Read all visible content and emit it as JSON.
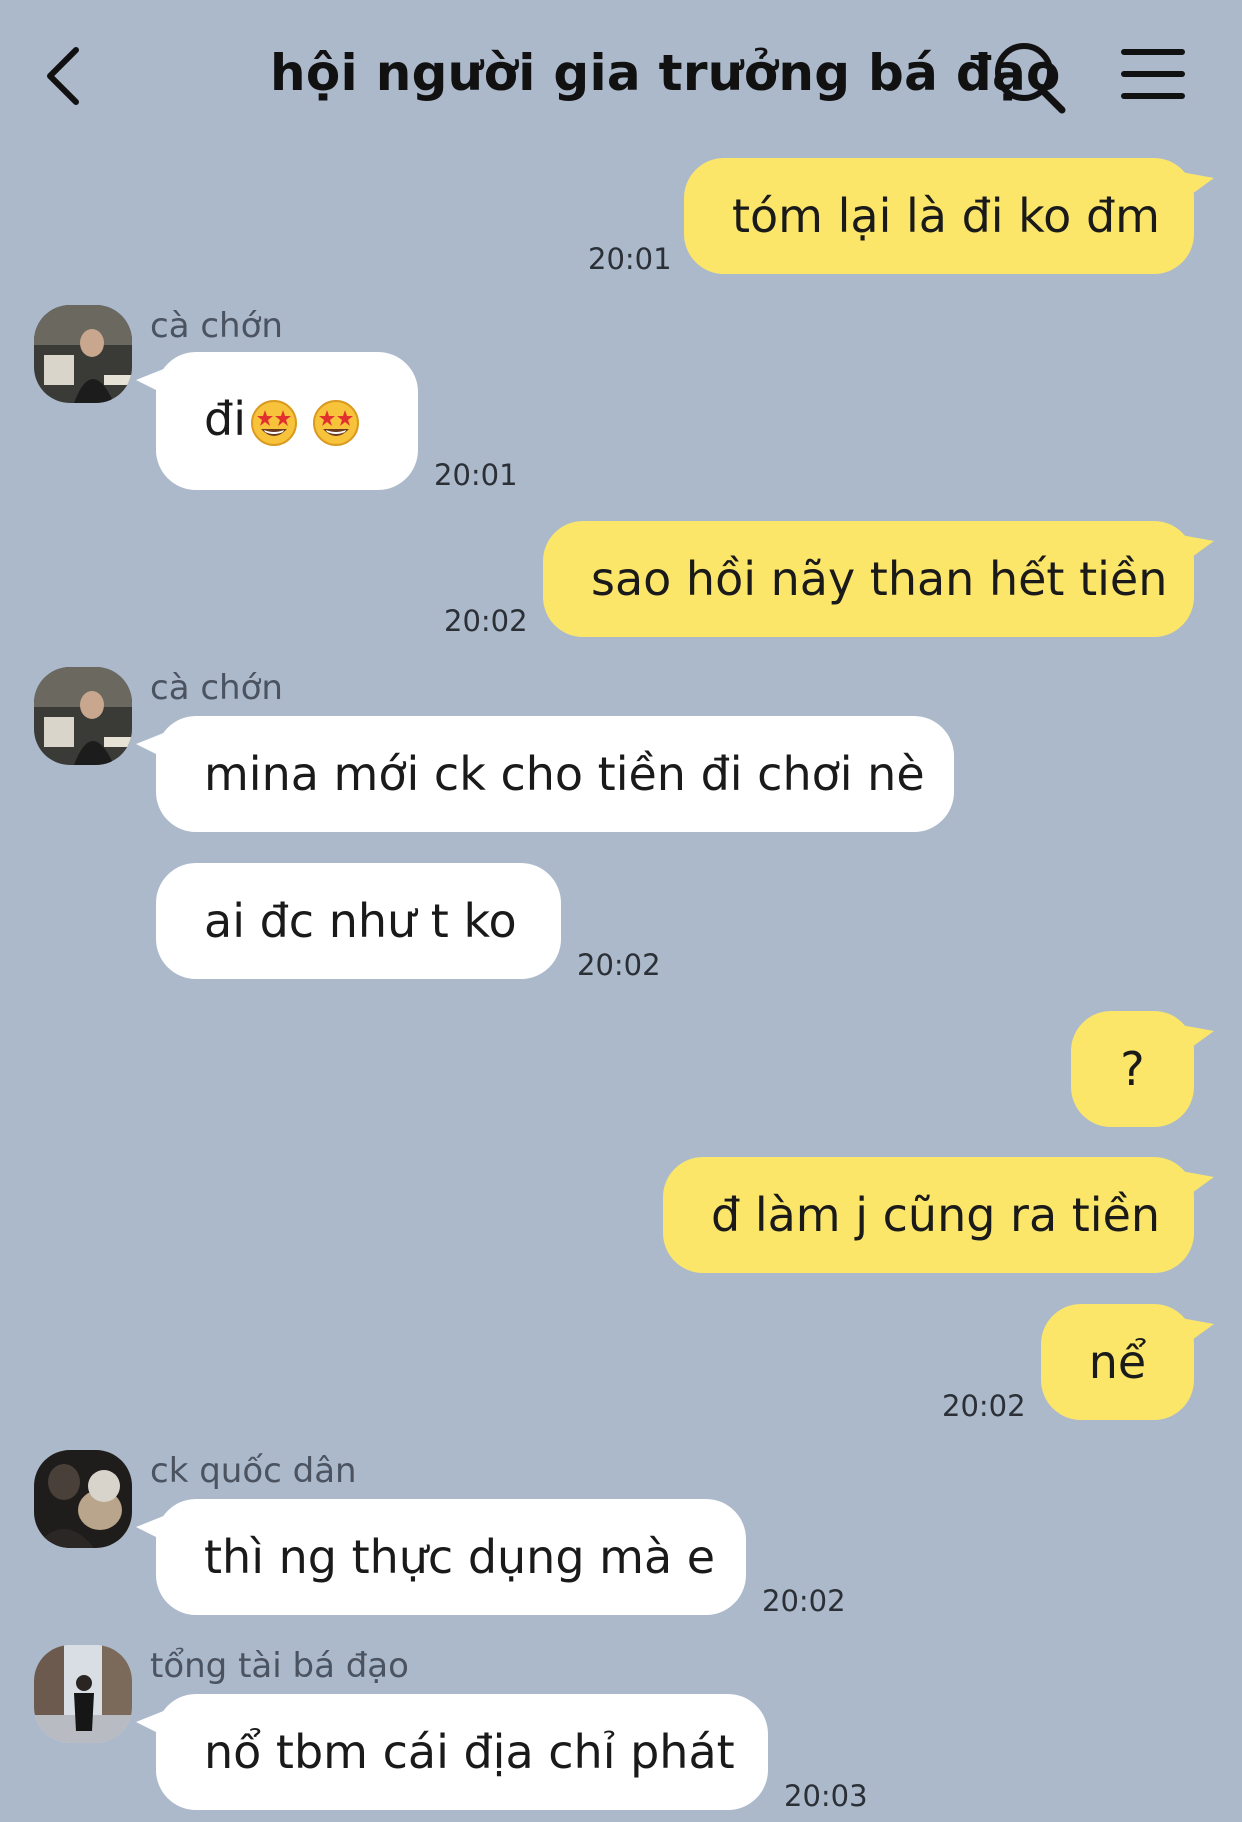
{
  "header": {
    "title": "hội người gia trưởng bá đạo",
    "back_icon": "chevron-left-icon",
    "search_icon": "search-icon",
    "menu_icon": "hamburger-menu-icon"
  },
  "colors": {
    "background": "#abb9cb",
    "my_bubble": "#fbe669",
    "their_bubble": "#ffffff"
  },
  "messages": [
    {
      "from": "me",
      "text": "tóm lại là đi ko đm",
      "time": "20:01"
    },
    {
      "from": "cà chớn",
      "text": "đi",
      "emoji": "star-struck-emoji x2",
      "time": "20:01"
    },
    {
      "from": "me",
      "text": "sao hồi nãy than hết tiền",
      "time": "20:02"
    },
    {
      "from": "cà chớn",
      "text": "mina mới ck cho tiền đi chơi nè"
    },
    {
      "from": "cà chớn",
      "text": "ai đc như t ko",
      "time": "20:02"
    },
    {
      "from": "me",
      "text": "?"
    },
    {
      "from": "me",
      "text": "đ làm j cũng ra tiền"
    },
    {
      "from": "me",
      "text": "nể",
      "time": "20:02"
    },
    {
      "from": "ck quốc dân",
      "text": "thì ng thực dụng mà e",
      "time": "20:02"
    },
    {
      "from": "tổng tài bá đạo",
      "text": "nổ tbm cái địa chỉ phát",
      "time": "20:03"
    }
  ],
  "senders": {
    "s1": "cà chớn",
    "s2": "cà chớn",
    "s3": "ck quốc dân",
    "s4": "tổng tài bá đạo"
  }
}
